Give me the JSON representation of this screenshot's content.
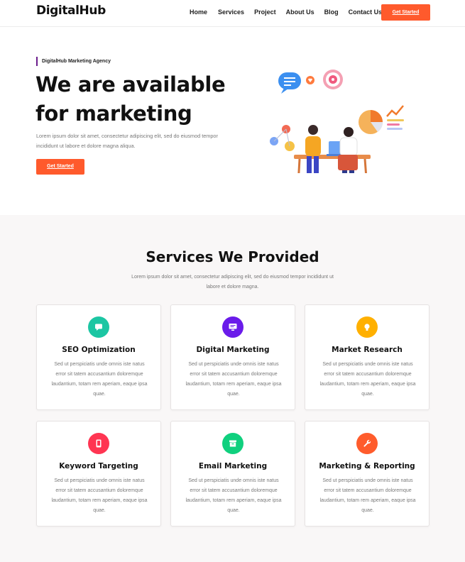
{
  "header": {
    "logo": "DigitalHub",
    "nav": [
      "Home",
      "Services",
      "Project",
      "About Us",
      "Blog",
      "Contact Us"
    ],
    "cta": "Get Started"
  },
  "hero": {
    "kicker": "DigitalHub Marketing Agency",
    "title_line1": "We are available",
    "title_line2": "for marketing",
    "description": "Lorem ipsum dolor sit amet, consectetur adipiscing elit, sed do eiusmod tempor incididunt ut labore et dolore magna aliqua.",
    "cta": "Get Started"
  },
  "services": {
    "title": "Services We Provided",
    "description": "Lorem ipsum dolor sit amet, consectetur adipiscing elit, sed do eiusmod tempor incididunt ut labore et dolore magna.",
    "cards": [
      {
        "title": "SEO Optimization",
        "icon": "chat-icon",
        "color": "#1cc6a3",
        "text": "Sed ut perspiciatis unde omnis iste natus error sit tatem accusantium doloremque laudantium, totam rem aperiam, eaque ipsa quae."
      },
      {
        "title": "Digital Marketing",
        "icon": "monitor-icon",
        "color": "#6a1bea",
        "text": "Sed ut perspiciatis unde omnis iste natus error sit tatem accusantium doloremque laudantium, totam rem aperiam, eaque ipsa quae."
      },
      {
        "title": "Market Research",
        "icon": "lightbulb-icon",
        "color": "#ffb000",
        "text": "Sed ut perspiciatis unde omnis iste natus error sit tatem accusantium doloremque laudantium, totam rem aperiam, eaque ipsa quae."
      },
      {
        "title": "Keyword Targeting",
        "icon": "phone-icon",
        "color": "#ff3552",
        "text": "Sed ut perspiciatis unde omnis iste natus error sit tatem accusantium doloremque laudantium, totam rem aperiam, eaque ipsa quae."
      },
      {
        "title": "Email Marketing",
        "icon": "archive-icon",
        "color": "#10d07e",
        "text": "Sed ut perspiciatis unde omnis iste natus error sit tatem accusantium doloremque laudantium, totam rem aperiam, eaque ipsa quae."
      },
      {
        "title": "Marketing & Reporting",
        "icon": "wrench-icon",
        "color": "#ff5c2c",
        "text": "Sed ut perspiciatis unde omnis iste natus error sit tatem accusantium doloremque laudantium, totam rem aperiam, eaque ipsa quae."
      }
    ]
  }
}
